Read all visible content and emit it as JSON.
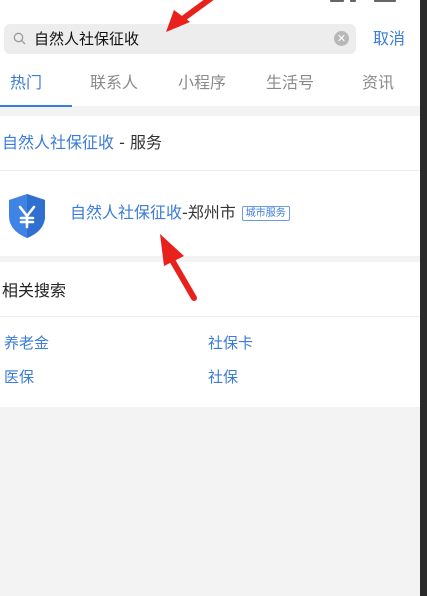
{
  "search": {
    "query": "自然人社保征收",
    "cancel_label": "取消"
  },
  "tabs": [
    "热门",
    "联系人",
    "小程序",
    "生活号",
    "资讯"
  ],
  "service_section": {
    "keyword": "自然人社保征收",
    "suffix": " - 服务",
    "item": {
      "name_highlight": "自然人社保征收",
      "name_rest": "-郑州市",
      "badge": "城市服务"
    }
  },
  "related": {
    "title": "相关搜索",
    "items": [
      "养老金",
      "社保卡",
      "医保",
      "社保"
    ]
  },
  "colors": {
    "accent": "#3b7bd9",
    "annotation_arrow": "#e8211c"
  }
}
